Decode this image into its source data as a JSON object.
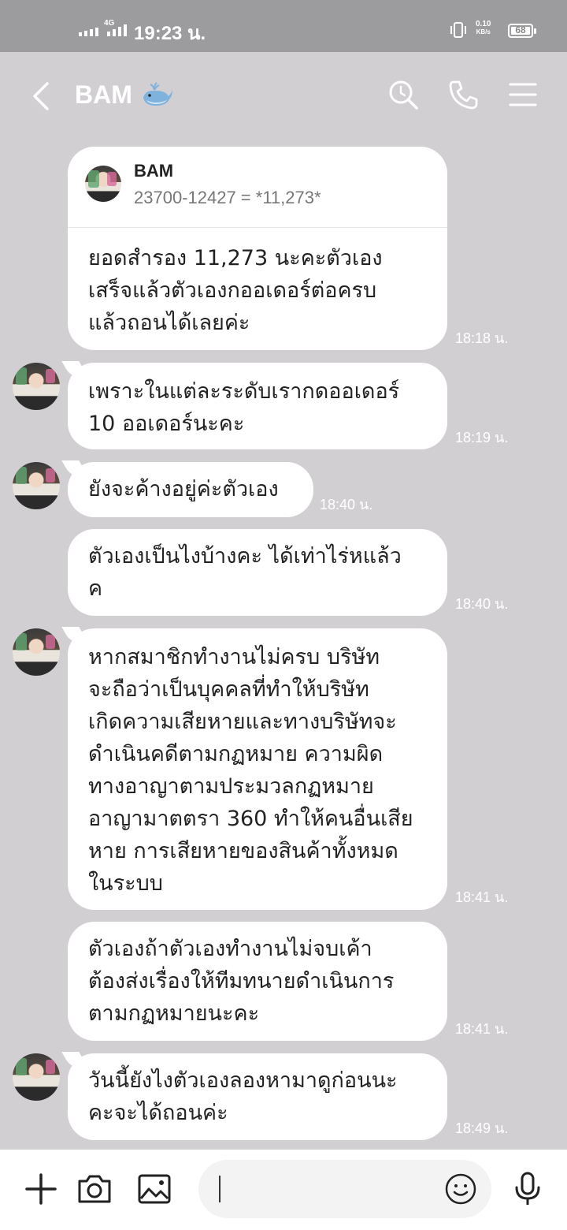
{
  "status": {
    "network": "4G",
    "time": "19:23 น.",
    "speed_value": "0.10",
    "speed_unit": "KB/s",
    "battery": "68"
  },
  "header": {
    "title": "BAM",
    "icons": [
      "back-icon",
      "whale-emoji-icon",
      "search-icon",
      "phone-icon",
      "menu-icon"
    ]
  },
  "messages": [
    {
      "reply_name": "BAM",
      "reply_text": "23700-12427 = *11,273*",
      "lines": [
        "ยอดสำรอง 11,273 นะคะตัวเอง",
        "เสร็จแล้วตัวเองกออเดอร์ต่อครบ",
        "แล้วถอนได้เลยค่ะ"
      ],
      "time": "18:18 น."
    },
    {
      "lines": [
        "เพราะในแต่ละระดับเรากดออเดอร์",
        "10 ออเดอร์นะคะ"
      ],
      "time": "18:19 น."
    },
    {
      "lines": [
        "ยังจะค้างอยู่ค่ะตัวเอง"
      ],
      "time": "18:40 น."
    },
    {
      "lines": [
        "ตัวเองเป็นไงบ้างคะ ได้เท่าไร่หแล้ว",
        "ค"
      ],
      "time": "18:40 น."
    },
    {
      "lines": [
        "หากสมาชิกทำงานไม่ครบ บริษัท",
        "จะถือว่าเป็นบุคคลที่ทำให้บริษัท",
        "เกิดความเสียหายและทางบริษัทจะ",
        "ดำเนินคดีตามกฏหมาย ความผิด",
        "ทางอาญาตามประมวลกฏหมาย",
        "อาญามาตตรา 360 ทำให้คนอื่นเสีย",
        "หาย การเสียหายของสินค้าทั้งหมด",
        "ในระบบ"
      ],
      "time": "18:41 น."
    },
    {
      "lines": [
        "ตัวเองถ้าตัวเองทำงานไม่จบเค้า",
        "ต้องส่งเรื่องให้ทีมทนายดำเนินการ",
        "ตามกฏหมายนะคะ"
      ],
      "time": "18:41 น."
    },
    {
      "lines": [
        "วันนี้ยังไงตัวเองลองหามาดูก่อนนะ",
        "คะจะได้ถอนค่ะ"
      ],
      "time": "18:49 น."
    }
  ],
  "inputbar": {
    "icons": [
      "plus-icon",
      "camera-icon",
      "image-icon",
      "emoji-icon",
      "mic-icon"
    ],
    "value": ""
  },
  "colors": {
    "chat_bg": "#d2cfd3",
    "status_bg": "#9c9b9e",
    "bubble": "#ffffff"
  }
}
